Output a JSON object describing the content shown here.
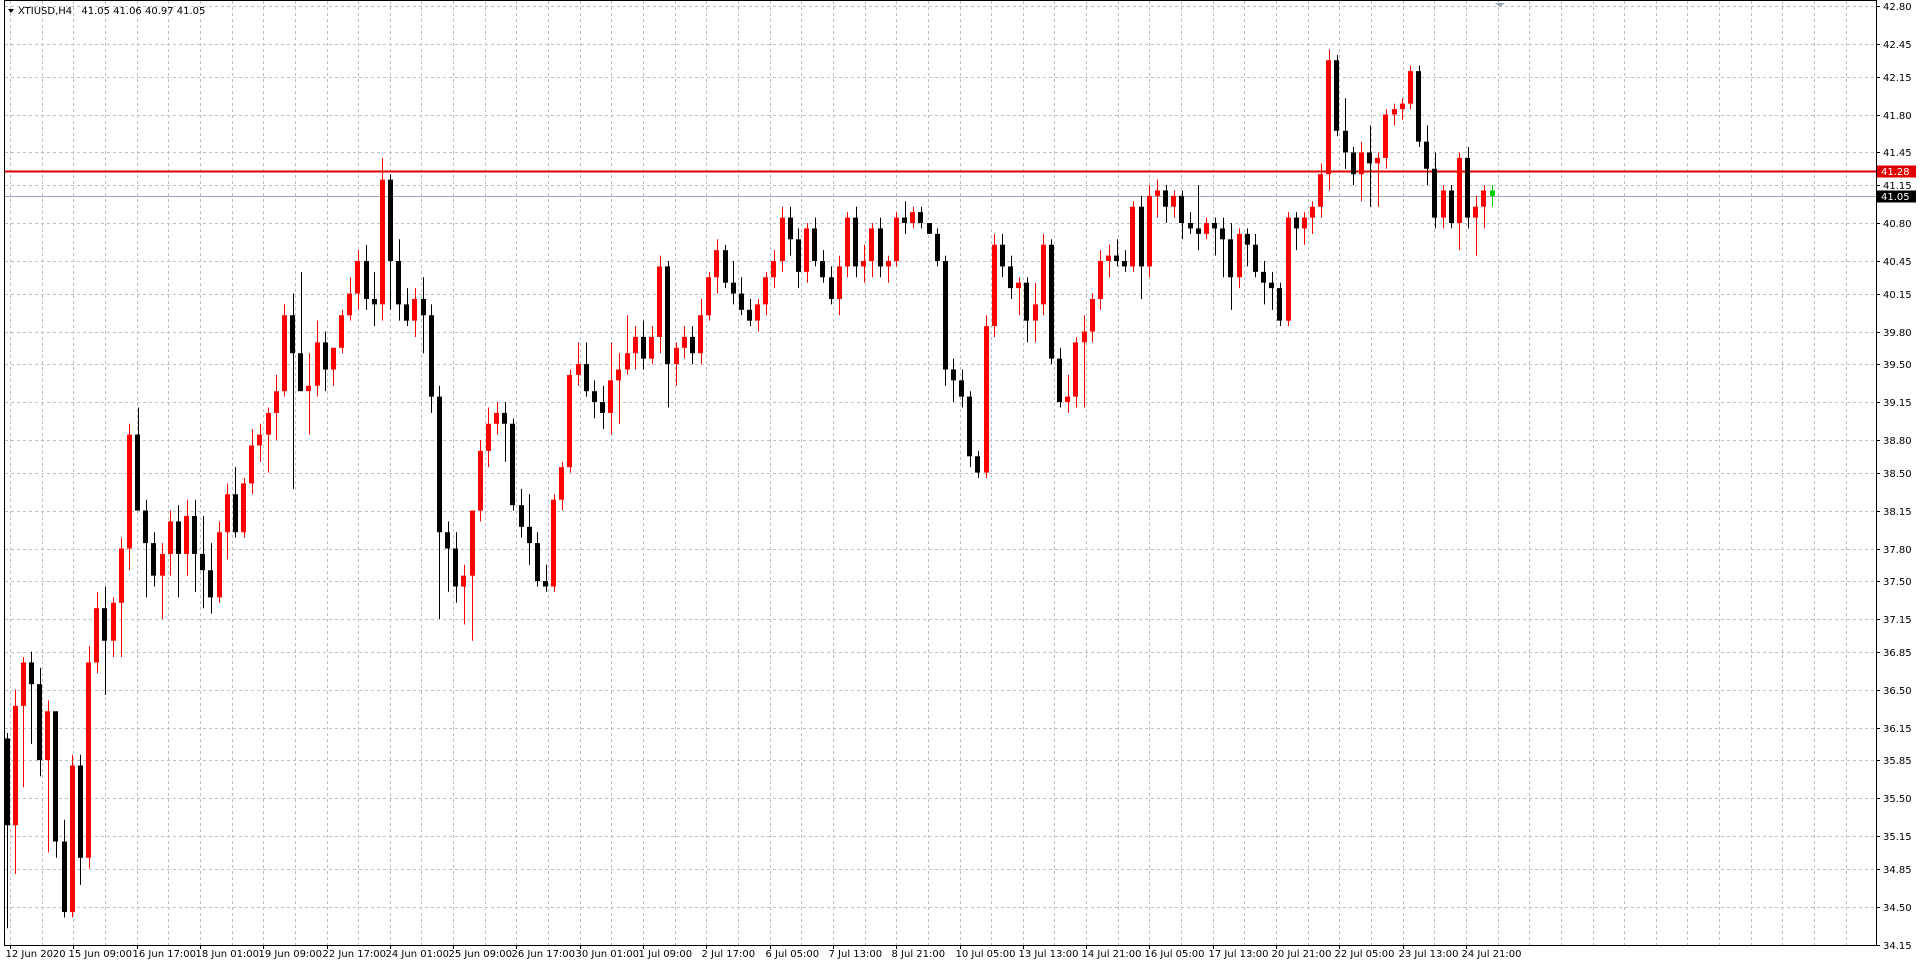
{
  "header": {
    "symbol": "XTIUSD,H4",
    "ohlc": "41.05 41.06 40.97 41.05"
  },
  "colors": {
    "bull": "#ff0000",
    "bear": "#000000",
    "wick_bull": "#ff0000",
    "wick_bear": "#000000",
    "doji": "#00cc00",
    "grid": "#c0c0c0",
    "resistance": "#e00000",
    "bid": "#9aa7b8"
  },
  "chart_data": {
    "type": "candlestick",
    "y_axis_labels": [
      "42.80",
      "42.45",
      "42.15",
      "41.80",
      "41.45",
      "41.15",
      "40.80",
      "40.45",
      "40.15",
      "39.80",
      "39.50",
      "39.15",
      "38.80",
      "38.50",
      "38.15",
      "37.80",
      "37.50",
      "37.15",
      "36.85",
      "36.50",
      "36.15",
      "35.85",
      "35.50",
      "35.15",
      "34.85",
      "34.50",
      "34.15"
    ],
    "x_axis_labels": [
      "12 Jun 2020",
      "15 Jun 09:00",
      "16 Jun 17:00",
      "18 Jun 01:00",
      "19 Jun 09:00",
      "22 Jun 17:00",
      "24 Jun 01:00",
      "25 Jun 09:00",
      "26 Jun 17:00",
      "30 Jun 01:00",
      "1 Jul 09:00",
      "2 Jul 17:00",
      "6 Jul 05:00",
      "7 Jul 13:00",
      "8 Jul 21:00",
      "10 Jul 05:00",
      "13 Jul 13:00",
      "14 Jul 21:00",
      "16 Jul 05:00",
      "17 Jul 13:00",
      "20 Jul 21:00",
      "22 Jul 05:00",
      "23 Jul 13:00",
      "24 Jul 21:00"
    ],
    "ylim": [
      34.1,
      42.8
    ],
    "grid": true,
    "horizontal_lines": [
      {
        "value": 41.28,
        "label": "41.28",
        "kind": "resistance"
      },
      {
        "value": 41.05,
        "label": "41.05",
        "kind": "bid"
      }
    ],
    "candles": [
      [
        36.05,
        36.1,
        34.3,
        35.25
      ],
      [
        35.25,
        36.5,
        34.8,
        36.35
      ],
      [
        36.35,
        36.8,
        35.6,
        36.75
      ],
      [
        36.75,
        36.85,
        36.0,
        36.55
      ],
      [
        36.55,
        36.7,
        35.7,
        35.85
      ],
      [
        35.85,
        36.4,
        35.0,
        36.3
      ],
      [
        36.3,
        36.3,
        34.95,
        35.1
      ],
      [
        35.1,
        35.3,
        34.4,
        34.45
      ],
      [
        34.45,
        35.9,
        34.4,
        35.8
      ],
      [
        35.8,
        35.9,
        34.7,
        34.95
      ],
      [
        34.95,
        36.9,
        34.85,
        36.75
      ],
      [
        36.75,
        37.4,
        36.65,
        37.25
      ],
      [
        37.25,
        37.45,
        36.45,
        36.95
      ],
      [
        36.95,
        37.35,
        36.8,
        37.3
      ],
      [
        37.3,
        37.9,
        36.8,
        37.8
      ],
      [
        37.8,
        38.95,
        37.6,
        38.85
      ],
      [
        38.85,
        39.1,
        38.2,
        38.15
      ],
      [
        38.15,
        38.25,
        37.35,
        37.85
      ],
      [
        37.85,
        37.95,
        37.45,
        37.55
      ],
      [
        37.55,
        37.85,
        37.15,
        37.75
      ],
      [
        37.75,
        38.15,
        37.55,
        38.05
      ],
      [
        38.05,
        38.2,
        37.35,
        37.75
      ],
      [
        37.75,
        38.25,
        37.55,
        38.1
      ],
      [
        38.1,
        38.25,
        37.4,
        37.75
      ],
      [
        37.75,
        38.1,
        37.25,
        37.6
      ],
      [
        37.6,
        37.85,
        37.2,
        37.35
      ],
      [
        37.35,
        38.05,
        37.3,
        37.95
      ],
      [
        37.95,
        38.4,
        37.7,
        38.3
      ],
      [
        38.3,
        38.55,
        37.9,
        37.95
      ],
      [
        37.95,
        38.45,
        37.9,
        38.4
      ],
      [
        38.4,
        38.9,
        38.3,
        38.75
      ],
      [
        38.75,
        38.95,
        38.6,
        38.85
      ],
      [
        38.85,
        39.1,
        38.5,
        39.05
      ],
      [
        39.05,
        39.4,
        38.8,
        39.25
      ],
      [
        39.25,
        40.05,
        39.2,
        39.95
      ],
      [
        39.95,
        40.15,
        38.35,
        39.6
      ],
      [
        39.6,
        40.35,
        39.5,
        39.25
      ],
      [
        39.25,
        39.6,
        38.85,
        39.3
      ],
      [
        39.3,
        39.9,
        39.2,
        39.7
      ],
      [
        39.7,
        39.8,
        39.25,
        39.45
      ],
      [
        39.45,
        39.65,
        39.3,
        39.65
      ],
      [
        39.65,
        40.0,
        39.6,
        39.95
      ],
      [
        39.95,
        40.3,
        39.9,
        40.15
      ],
      [
        40.15,
        40.55,
        40.0,
        40.45
      ],
      [
        40.45,
        40.6,
        40.0,
        40.1
      ],
      [
        40.1,
        40.35,
        39.85,
        40.05
      ],
      [
        40.05,
        41.4,
        39.9,
        41.2
      ],
      [
        41.2,
        41.25,
        40.0,
        40.45
      ],
      [
        40.45,
        40.65,
        39.9,
        40.05
      ],
      [
        40.05,
        40.2,
        39.85,
        39.9
      ],
      [
        39.9,
        40.2,
        39.75,
        40.1
      ],
      [
        40.1,
        40.3,
        39.6,
        39.95
      ],
      [
        39.95,
        40.05,
        39.05,
        39.2
      ],
      [
        39.2,
        39.3,
        37.15,
        37.95
      ],
      [
        37.95,
        38.05,
        37.4,
        37.8
      ],
      [
        37.8,
        37.95,
        37.3,
        37.45
      ],
      [
        37.45,
        37.65,
        37.1,
        37.55
      ],
      [
        37.55,
        38.0,
        36.95,
        38.15
      ],
      [
        38.15,
        38.8,
        38.05,
        38.7
      ],
      [
        38.7,
        39.1,
        38.55,
        38.95
      ],
      [
        38.95,
        39.15,
        38.85,
        39.05
      ],
      [
        39.05,
        39.15,
        38.6,
        38.95
      ],
      [
        38.95,
        39.0,
        38.15,
        38.2
      ],
      [
        38.2,
        38.35,
        37.9,
        38.0
      ],
      [
        38.0,
        38.3,
        37.65,
        37.85
      ],
      [
        37.85,
        37.95,
        37.45,
        37.5
      ],
      [
        37.5,
        37.65,
        37.4,
        37.45
      ],
      [
        37.45,
        38.3,
        37.4,
        38.25
      ],
      [
        38.25,
        38.6,
        38.15,
        38.55
      ],
      [
        38.55,
        39.45,
        38.5,
        39.4
      ],
      [
        39.4,
        39.7,
        39.3,
        39.5
      ],
      [
        39.5,
        39.7,
        39.2,
        39.25
      ],
      [
        39.25,
        39.35,
        39.0,
        39.15
      ],
      [
        39.15,
        39.3,
        38.9,
        39.05
      ],
      [
        39.05,
        39.7,
        38.85,
        39.35
      ],
      [
        39.35,
        39.6,
        38.95,
        39.45
      ],
      [
        39.45,
        39.95,
        39.4,
        39.6
      ],
      [
        39.6,
        39.85,
        39.45,
        39.75
      ],
      [
        39.75,
        39.9,
        39.45,
        39.55
      ],
      [
        39.55,
        39.85,
        39.5,
        39.75
      ],
      [
        39.75,
        40.5,
        39.6,
        40.4
      ],
      [
        40.4,
        40.45,
        39.1,
        39.5
      ],
      [
        39.5,
        39.7,
        39.3,
        39.65
      ],
      [
        39.65,
        39.85,
        39.55,
        39.75
      ],
      [
        39.75,
        39.85,
        39.5,
        39.6
      ],
      [
        39.6,
        40.1,
        39.5,
        39.95
      ],
      [
        39.95,
        40.35,
        39.9,
        40.3
      ],
      [
        40.3,
        40.65,
        40.15,
        40.55
      ],
      [
        40.55,
        40.6,
        40.2,
        40.25
      ],
      [
        40.25,
        40.45,
        40.05,
        40.15
      ],
      [
        40.15,
        40.3,
        39.95,
        40.0
      ],
      [
        40.0,
        40.1,
        39.85,
        39.9
      ],
      [
        39.9,
        40.1,
        39.8,
        40.05
      ],
      [
        40.05,
        40.35,
        39.95,
        40.3
      ],
      [
        40.3,
        40.55,
        40.2,
        40.45
      ],
      [
        40.45,
        40.95,
        40.35,
        40.85
      ],
      [
        40.85,
        40.95,
        40.5,
        40.65
      ],
      [
        40.65,
        40.75,
        40.2,
        40.35
      ],
      [
        40.35,
        40.8,
        40.25,
        40.75
      ],
      [
        40.75,
        40.85,
        40.4,
        40.45
      ],
      [
        40.45,
        40.55,
        40.25,
        40.3
      ],
      [
        40.3,
        40.4,
        40.05,
        40.1
      ],
      [
        40.1,
        40.5,
        39.95,
        40.4
      ],
      [
        40.4,
        40.9,
        40.3,
        40.85
      ],
      [
        40.85,
        40.95,
        40.3,
        40.4
      ],
      [
        40.4,
        40.6,
        40.25,
        40.45
      ],
      [
        40.45,
        40.8,
        40.3,
        40.75
      ],
      [
        40.75,
        40.85,
        40.3,
        40.4
      ],
      [
        40.4,
        40.5,
        40.25,
        40.45
      ],
      [
        40.45,
        40.9,
        40.4,
        40.85
      ],
      [
        40.85,
        41.0,
        40.7,
        40.8
      ],
      [
        40.8,
        40.95,
        40.75,
        40.9
      ],
      [
        40.9,
        40.95,
        40.75,
        40.8
      ],
      [
        40.8,
        40.8,
        40.7,
        40.7
      ],
      [
        40.7,
        40.75,
        40.4,
        40.45
      ],
      [
        40.45,
        40.5,
        39.3,
        39.45
      ],
      [
        39.45,
        39.55,
        39.15,
        39.35
      ],
      [
        39.35,
        39.45,
        39.1,
        39.2
      ],
      [
        39.2,
        39.25,
        38.55,
        38.65
      ],
      [
        38.65,
        38.7,
        38.45,
        38.5
      ],
      [
        38.5,
        39.95,
        38.45,
        39.85
      ],
      [
        39.85,
        40.7,
        39.75,
        40.6
      ],
      [
        40.6,
        40.7,
        40.3,
        40.4
      ],
      [
        40.4,
        40.5,
        40.1,
        40.2
      ],
      [
        40.2,
        40.3,
        39.95,
        40.25
      ],
      [
        40.25,
        40.3,
        39.7,
        39.9
      ],
      [
        39.9,
        40.25,
        39.7,
        40.05
      ],
      [
        40.05,
        40.7,
        39.95,
        40.6
      ],
      [
        40.6,
        40.65,
        39.5,
        39.55
      ],
      [
        39.55,
        39.65,
        39.1,
        39.15
      ],
      [
        39.15,
        39.4,
        39.05,
        39.2
      ],
      [
        39.2,
        39.75,
        39.1,
        39.7
      ],
      [
        39.7,
        39.95,
        39.1,
        39.8
      ],
      [
        39.8,
        40.15,
        39.7,
        40.1
      ],
      [
        40.1,
        40.55,
        40.0,
        40.45
      ],
      [
        40.45,
        40.6,
        40.3,
        40.5
      ],
      [
        40.5,
        40.65,
        40.4,
        40.45
      ],
      [
        40.45,
        40.55,
        40.35,
        40.4
      ],
      [
        40.4,
        41.0,
        40.35,
        40.95
      ],
      [
        40.95,
        41.05,
        40.1,
        40.4
      ],
      [
        40.4,
        41.15,
        40.3,
        41.05
      ],
      [
        41.05,
        41.2,
        40.85,
        41.1
      ],
      [
        41.1,
        41.15,
        40.8,
        40.95
      ],
      [
        40.95,
        41.1,
        40.85,
        41.05
      ],
      [
        41.05,
        41.1,
        40.65,
        40.8
      ],
      [
        40.8,
        40.9,
        40.7,
        40.75
      ],
      [
        40.75,
        41.15,
        40.55,
        40.7
      ],
      [
        40.7,
        40.85,
        40.65,
        40.8
      ],
      [
        40.8,
        40.85,
        40.5,
        40.75
      ],
      [
        40.75,
        40.85,
        40.3,
        40.65
      ],
      [
        40.65,
        40.8,
        40.0,
        40.3
      ],
      [
        40.3,
        40.75,
        40.2,
        40.7
      ],
      [
        40.7,
        40.75,
        40.4,
        40.6
      ],
      [
        40.6,
        40.7,
        40.3,
        40.35
      ],
      [
        40.35,
        40.45,
        40.05,
        40.25
      ],
      [
        40.25,
        40.35,
        40.0,
        40.2
      ],
      [
        40.2,
        40.25,
        39.85,
        39.9
      ],
      [
        39.9,
        40.9,
        39.85,
        40.85
      ],
      [
        40.85,
        40.9,
        40.55,
        40.75
      ],
      [
        40.75,
        40.9,
        40.6,
        40.85
      ],
      [
        40.85,
        41.0,
        40.7,
        40.95
      ],
      [
        40.95,
        41.35,
        40.85,
        41.25
      ],
      [
        41.25,
        42.4,
        41.1,
        42.3
      ],
      [
        42.3,
        42.35,
        41.6,
        41.65
      ],
      [
        41.65,
        41.95,
        41.3,
        41.45
      ],
      [
        41.45,
        41.5,
        41.15,
        41.25
      ],
      [
        41.25,
        41.55,
        41.0,
        41.45
      ],
      [
        41.45,
        41.7,
        40.95,
        41.35
      ],
      [
        41.35,
        41.45,
        40.95,
        41.4
      ],
      [
        41.4,
        41.85,
        41.3,
        41.8
      ],
      [
        41.8,
        41.9,
        41.7,
        41.85
      ],
      [
        41.85,
        41.95,
        41.75,
        41.9
      ],
      [
        41.9,
        42.25,
        41.85,
        42.2
      ],
      [
        42.2,
        42.25,
        41.5,
        41.55
      ],
      [
        41.55,
        41.7,
        41.15,
        41.3
      ],
      [
        41.3,
        41.45,
        40.75,
        40.85
      ],
      [
        40.85,
        41.15,
        40.75,
        41.1
      ],
      [
        41.1,
        41.15,
        40.75,
        40.8
      ],
      [
        40.8,
        41.45,
        40.55,
        41.4
      ],
      [
        41.4,
        41.5,
        40.75,
        40.85
      ],
      [
        40.85,
        41.05,
        40.5,
        40.95
      ],
      [
        40.95,
        41.15,
        40.75,
        41.1
      ],
      [
        41.1,
        41.15,
        40.95,
        41.05
      ]
    ]
  }
}
